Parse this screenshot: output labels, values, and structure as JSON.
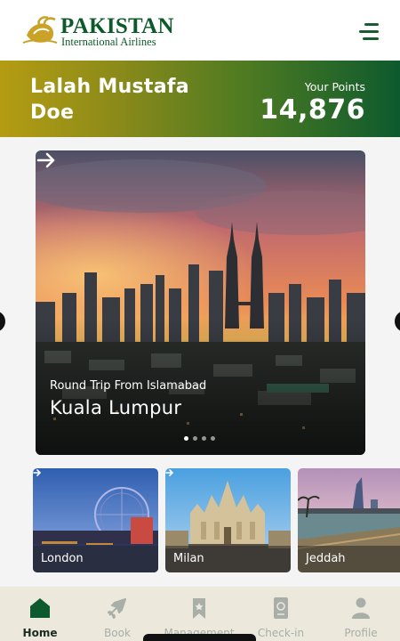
{
  "brand": {
    "name": "PAKISTAN",
    "tagline": "International Airlines"
  },
  "header": {
    "menu_icon": "hamburger-menu-icon"
  },
  "banner": {
    "user_name": "Lalah Mustafa Doe",
    "points_label": "Your Points",
    "points_value": "14,876"
  },
  "hero": {
    "subtitle": "Round Trip From Islamabad",
    "destination": "Kuala Lumpur",
    "slide_count": 4,
    "active_slide": 1
  },
  "destinations": [
    {
      "name": "London"
    },
    {
      "name": "Milan"
    },
    {
      "name": "Jeddah"
    }
  ],
  "tabs": [
    {
      "label": "Home",
      "icon": "home-icon",
      "active": true
    },
    {
      "label": "Book",
      "icon": "airplane-icon",
      "active": false
    },
    {
      "label": "Management",
      "icon": "bookmark-icon",
      "active": false
    },
    {
      "label": "Check-in",
      "icon": "boarding-pass-icon",
      "active": false
    },
    {
      "label": "Profile",
      "icon": "person-icon",
      "active": false
    }
  ],
  "colors": {
    "brand_green": "#0c5a2a",
    "banner_start": "#b49c12",
    "banner_end": "#0d5a2e",
    "tab_bar": "#ece9dc"
  }
}
